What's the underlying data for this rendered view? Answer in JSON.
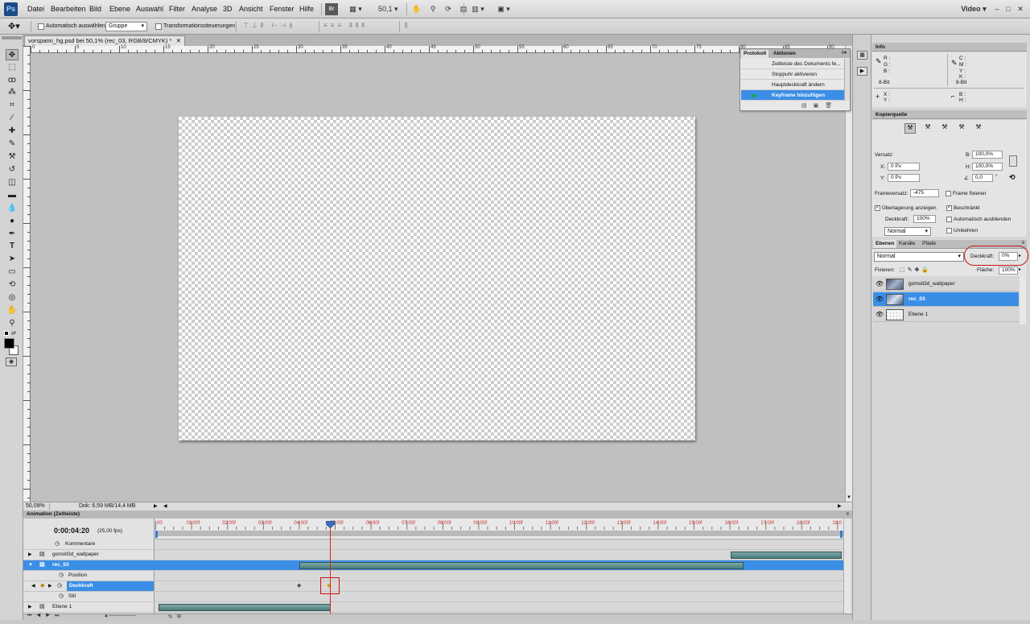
{
  "menubar": {
    "logo": "Ps",
    "items": [
      "Datei",
      "Bearbeiten",
      "Bild",
      "Ebene",
      "Auswahl",
      "Filter",
      "Analyse",
      "3D",
      "Ansicht",
      "Fenster",
      "Hilfe"
    ],
    "zoom": "50,1",
    "workspace": "Video"
  },
  "options": {
    "auto_select_label": "Automatisch auswählen:",
    "auto_select_value": "Gruppe",
    "transform_label": "Transformationssteuerungen"
  },
  "doc": {
    "tab_title": "vorspann_hg.psd bei 50,1% (rec_03, RGB/8/CMYK) *",
    "zoom_status": "50,09%",
    "doc_status": "Dok: 6,59 MB/14,4 MB"
  },
  "ruler_top": [
    "0",
    "5",
    "10",
    "15",
    "20",
    "25",
    "30",
    "35",
    "40",
    "45",
    "50",
    "55",
    "60",
    "65",
    "70",
    "75",
    "80",
    "85",
    "90",
    "95"
  ],
  "history": {
    "tabs": [
      "Protokoll",
      "Aktionen"
    ],
    "items": [
      "Zeitleiste des Dokuments fe...",
      "Stoppuhr aktivieren",
      "Hauptdeckkraft ändern",
      "Keyframe hinzufügen"
    ],
    "active_index": 3
  },
  "info": {
    "title": "Info",
    "left_labels": [
      "R :",
      "G :",
      "B :"
    ],
    "right_labels": [
      "C :",
      "M :",
      "Y :",
      "K :"
    ],
    "bit_left": "8-Bit",
    "bit_right": "8-Bit",
    "xy": [
      "X :",
      "Y :"
    ],
    "bh": [
      "B :",
      "H :"
    ]
  },
  "kopierquelle": {
    "title": "Kopierquelle",
    "versatz": "Versatz:",
    "x_label": "X:",
    "x_value": "0 Px",
    "y_label": "Y:",
    "y_value": "0 Px",
    "b_label": "B:",
    "b_value": "100,0%",
    "h_label": "H:",
    "h_value": "100,0%",
    "angle_value": "0,0",
    "angle_unit": "°",
    "frameversatz_label": "Frameversatz:",
    "frameversatz_value": "-475",
    "frame_fixieren": "Frame fixieren",
    "overlay_label": "Überlagerung anzeigen",
    "beschraenkt": "Beschränkt",
    "deckkraft_label": "Deckkraft:",
    "deckkraft_value": "100%",
    "auto_ausblenden": "Automatisch ausblenden",
    "mode": "Normal",
    "umkehren": "Umkehren"
  },
  "layers": {
    "tabs": [
      "Ebenen",
      "Kanäle",
      "Pfade"
    ],
    "blend_mode": "Normal",
    "opacity_label": "Deckkraft:",
    "opacity_value": "0%",
    "fixieren_label": "Fixieren:",
    "flaeche_label": "Fläche:",
    "flaeche_value": "100%",
    "items": [
      {
        "name": "gomoll3d_wallpaper",
        "selected": false
      },
      {
        "name": "rec_03",
        "selected": true
      },
      {
        "name": "Ebene 1",
        "selected": false
      }
    ]
  },
  "timeline": {
    "title": "Animation (Zeitleiste)",
    "timecode": "0:00:04:20",
    "fps": "(25,00 fps)",
    "ticks": [
      "00",
      "01:00f",
      "02:00f",
      "03:00f",
      "04:00f",
      "05:00f",
      "06:00f",
      "07:00f",
      "08:00f",
      "09:00f",
      "10:00f",
      "11:00f",
      "12:00f",
      "13:00f",
      "14:00f",
      "15:00f",
      "16:00f",
      "17:00f",
      "18:00f",
      "19:0"
    ],
    "rows": [
      "Kommentare",
      "gomoll3d_wallpaper",
      "rec_03",
      "Position",
      "Deckkraft",
      "Stil",
      "Ebene 1"
    ]
  },
  "colors": {
    "selection": "#3a8ee6",
    "bar": "#4a7d7d",
    "playhead": "#dd2222",
    "annotation": "#cc1111"
  }
}
